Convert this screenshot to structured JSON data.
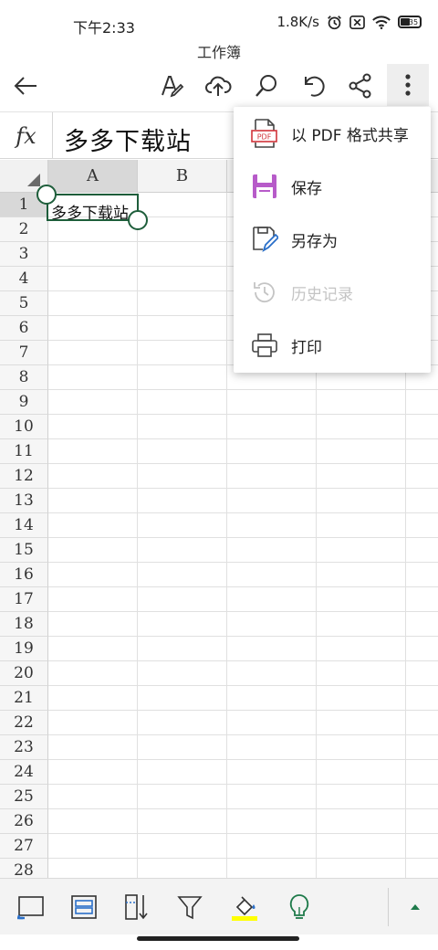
{
  "status_bar": {
    "time": "下午2:33",
    "network_speed": "1.8K/s",
    "battery_level": "35"
  },
  "document": {
    "title": "工作簿"
  },
  "toolbar": {
    "icons": [
      "back-arrow-icon",
      "draw-pen-icon",
      "cloud-upload-icon",
      "search-icon",
      "undo-icon",
      "share-icon",
      "more-vertical-icon"
    ]
  },
  "formula_bar": {
    "fx_label": "fx",
    "value": "多多下载站"
  },
  "grid": {
    "columns": [
      "A",
      "B"
    ],
    "rows": [
      "1",
      "2",
      "3",
      "4",
      "5",
      "6",
      "7",
      "8",
      "9",
      "10",
      "11",
      "12",
      "13",
      "14",
      "15",
      "16",
      "17",
      "18",
      "19",
      "20",
      "21",
      "22",
      "23",
      "24",
      "25",
      "26",
      "27",
      "28"
    ],
    "selected_cell": "A1",
    "cell_a1": "多多下载站"
  },
  "menu": {
    "items": [
      {
        "label": "以 PDF 格式共享",
        "icon": "pdf-icon",
        "enabled": true
      },
      {
        "label": "保存",
        "icon": "save-icon",
        "enabled": true
      },
      {
        "label": "另存为",
        "icon": "save-as-icon",
        "enabled": true
      },
      {
        "label": "历史记录",
        "icon": "history-icon",
        "enabled": false
      },
      {
        "label": "打印",
        "icon": "print-icon",
        "enabled": true
      }
    ]
  },
  "bottom_toolbar": {
    "icons": [
      "freeze-panes-icon",
      "card-view-icon",
      "sort-icon",
      "filter-icon",
      "fill-color-icon",
      "ideas-lightbulb-icon",
      "expand-up-icon"
    ],
    "fill_color": "#ffff00",
    "accent_color": "#1e5e3b"
  }
}
